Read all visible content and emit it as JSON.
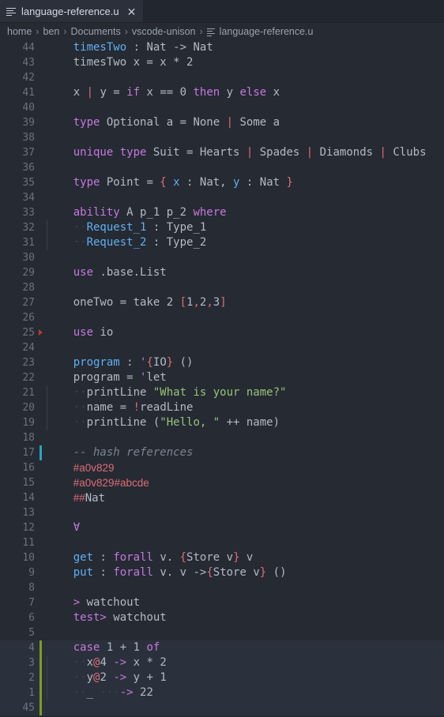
{
  "window": {
    "background": "#252a33",
    "accent_modified": "#7f9c22",
    "accent_cursor": "#2aa5bf"
  },
  "tab": {
    "icon": "file-lines-icon",
    "label": "language-reference.u",
    "close_label": "✕"
  },
  "breadcrumb": {
    "separator": "›",
    "items": [
      "home",
      "ben",
      "Documents",
      "vscode-unison"
    ],
    "file_icon": "file-lines-icon",
    "file": "language-reference.u"
  },
  "editor": {
    "language": "unison",
    "last_line_number": "45",
    "lines": [
      {
        "n": "44",
        "mark": "none",
        "tokens": [
          {
            "t": "    ",
            "c": "plain"
          },
          {
            "t": "timesTwo",
            "c": "fn"
          },
          {
            "t": " : ",
            "c": "plain"
          },
          {
            "t": "Nat",
            "c": "plain"
          },
          {
            "t": " -> ",
            "c": "plain"
          },
          {
            "t": "Nat",
            "c": "plain"
          }
        ]
      },
      {
        "n": "43",
        "mark": "none",
        "tokens": [
          {
            "t": "    timesTwo x = x * 2",
            "c": "plain"
          }
        ]
      },
      {
        "n": "42",
        "mark": "none",
        "tokens": []
      },
      {
        "n": "41",
        "mark": "none",
        "tokens": [
          {
            "t": "    x ",
            "c": "plain"
          },
          {
            "t": "|",
            "c": "pnc"
          },
          {
            "t": " y = ",
            "c": "plain"
          },
          {
            "t": "if",
            "c": "kw"
          },
          {
            "t": " x == 0 ",
            "c": "plain"
          },
          {
            "t": "then",
            "c": "kw"
          },
          {
            "t": " y ",
            "c": "plain"
          },
          {
            "t": "else",
            "c": "kw"
          },
          {
            "t": " x",
            "c": "plain"
          }
        ]
      },
      {
        "n": "40",
        "mark": "none",
        "tokens": []
      },
      {
        "n": "39",
        "mark": "none",
        "tokens": [
          {
            "t": "    ",
            "c": "plain"
          },
          {
            "t": "type",
            "c": "kw"
          },
          {
            "t": " Optional a = None ",
            "c": "plain"
          },
          {
            "t": "|",
            "c": "pnc"
          },
          {
            "t": " Some a",
            "c": "plain"
          }
        ]
      },
      {
        "n": "38",
        "mark": "none",
        "tokens": []
      },
      {
        "n": "37",
        "mark": "none",
        "tokens": [
          {
            "t": "    ",
            "c": "plain"
          },
          {
            "t": "unique type",
            "c": "kw"
          },
          {
            "t": " Suit = Hearts ",
            "c": "plain"
          },
          {
            "t": "|",
            "c": "pnc"
          },
          {
            "t": " Spades ",
            "c": "plain"
          },
          {
            "t": "|",
            "c": "pnc"
          },
          {
            "t": " Diamonds ",
            "c": "plain"
          },
          {
            "t": "|",
            "c": "pnc"
          },
          {
            "t": " Clubs",
            "c": "plain"
          }
        ]
      },
      {
        "n": "36",
        "mark": "none",
        "tokens": []
      },
      {
        "n": "35",
        "mark": "none",
        "tokens": [
          {
            "t": "    ",
            "c": "plain"
          },
          {
            "t": "type",
            "c": "kw"
          },
          {
            "t": " Point = ",
            "c": "plain"
          },
          {
            "t": "{",
            "c": "pnc"
          },
          {
            "t": " ",
            "c": "plain"
          },
          {
            "t": "x",
            "c": "fn"
          },
          {
            "t": " : Nat, ",
            "c": "plain"
          },
          {
            "t": "y",
            "c": "fn"
          },
          {
            "t": " : Nat ",
            "c": "plain"
          },
          {
            "t": "}",
            "c": "pnc"
          }
        ]
      },
      {
        "n": "34",
        "mark": "none",
        "tokens": []
      },
      {
        "n": "33",
        "mark": "none",
        "tokens": [
          {
            "t": "    ",
            "c": "plain"
          },
          {
            "t": "ability",
            "c": "kw"
          },
          {
            "t": " A p_1 p_2 ",
            "c": "plain"
          },
          {
            "t": "where",
            "c": "kw"
          }
        ]
      },
      {
        "n": "32",
        "mark": "none",
        "indent": 1,
        "tokens": [
          {
            "t": "    ",
            "c": "plain"
          },
          {
            "t": "··",
            "c": "dot"
          },
          {
            "t": "Request_1",
            "c": "fn"
          },
          {
            "t": " : Type_1",
            "c": "plain"
          }
        ]
      },
      {
        "n": "31",
        "mark": "none",
        "indent": 1,
        "tokens": [
          {
            "t": "    ",
            "c": "plain"
          },
          {
            "t": "··",
            "c": "dot"
          },
          {
            "t": "Request_2",
            "c": "fn"
          },
          {
            "t": " : Type_2",
            "c": "plain"
          }
        ]
      },
      {
        "n": "30",
        "mark": "none",
        "tokens": []
      },
      {
        "n": "29",
        "mark": "none",
        "tokens": [
          {
            "t": "    ",
            "c": "plain"
          },
          {
            "t": "use",
            "c": "kw"
          },
          {
            "t": " .base.List",
            "c": "plain"
          }
        ]
      },
      {
        "n": "28",
        "mark": "none",
        "tokens": []
      },
      {
        "n": "27",
        "mark": "none",
        "tokens": [
          {
            "t": "    oneTwo = take 2 ",
            "c": "plain"
          },
          {
            "t": "[",
            "c": "pnc"
          },
          {
            "t": "1",
            "c": "plain"
          },
          {
            "t": ",",
            "c": "pnc"
          },
          {
            "t": "2",
            "c": "plain"
          },
          {
            "t": ",",
            "c": "pnc"
          },
          {
            "t": "3",
            "c": "plain"
          },
          {
            "t": "]",
            "c": "pnc"
          }
        ]
      },
      {
        "n": "26",
        "mark": "none",
        "tokens": []
      },
      {
        "n": "25",
        "mark": "fold",
        "tokens": [
          {
            "t": "    ",
            "c": "plain"
          },
          {
            "t": "use",
            "c": "kw"
          },
          {
            "t": " io",
            "c": "plain"
          }
        ]
      },
      {
        "n": "24",
        "mark": "none",
        "tokens": []
      },
      {
        "n": "23",
        "mark": "none",
        "tokens": [
          {
            "t": "    ",
            "c": "plain"
          },
          {
            "t": "program",
            "c": "fn"
          },
          {
            "t": " : ",
            "c": "plain"
          },
          {
            "t": "'",
            "c": "kw"
          },
          {
            "t": "{",
            "c": "pnc"
          },
          {
            "t": "IO",
            "c": "plain"
          },
          {
            "t": "}",
            "c": "pnc"
          },
          {
            "t": " ()",
            "c": "plain"
          }
        ]
      },
      {
        "n": "22",
        "mark": "none",
        "tokens": [
          {
            "t": "    program = ",
            "c": "plain"
          },
          {
            "t": "'",
            "c": "kw"
          },
          {
            "t": "let",
            "c": "plain"
          }
        ]
      },
      {
        "n": "21",
        "mark": "none",
        "indent": 1,
        "tokens": [
          {
            "t": "    ",
            "c": "plain"
          },
          {
            "t": "··",
            "c": "dot"
          },
          {
            "t": "printLine ",
            "c": "plain"
          },
          {
            "t": "\"What is your name?\"",
            "c": "str"
          }
        ]
      },
      {
        "n": "20",
        "mark": "none",
        "indent": 1,
        "tokens": [
          {
            "t": "    ",
            "c": "plain"
          },
          {
            "t": "··",
            "c": "dot"
          },
          {
            "t": "name = ",
            "c": "plain"
          },
          {
            "t": "!",
            "c": "pnc"
          },
          {
            "t": "readLine",
            "c": "plain"
          }
        ]
      },
      {
        "n": "19",
        "mark": "none",
        "indent": 1,
        "tokens": [
          {
            "t": "    ",
            "c": "plain"
          },
          {
            "t": "··",
            "c": "dot"
          },
          {
            "t": "printLine (",
            "c": "plain"
          },
          {
            "t": "\"Hello, \"",
            "c": "str"
          },
          {
            "t": " ++ name)",
            "c": "plain"
          }
        ]
      },
      {
        "n": "18",
        "mark": "none",
        "tokens": []
      },
      {
        "n": "17",
        "mark": "cursorbar",
        "tokens": [
          {
            "t": "    ",
            "c": "plain"
          },
          {
            "t": "-- hash references",
            "c": "cmt"
          }
        ]
      },
      {
        "n": "16",
        "mark": "none",
        "tokens": [
          {
            "t": "    ",
            "c": "plain"
          },
          {
            "t": "#a0v829",
            "c": "hash"
          }
        ]
      },
      {
        "n": "15",
        "mark": "none",
        "tokens": [
          {
            "t": "    ",
            "c": "plain"
          },
          {
            "t": "#a0v829#abcde",
            "c": "hash"
          }
        ]
      },
      {
        "n": "14",
        "mark": "none",
        "tokens": [
          {
            "t": "    ",
            "c": "plain"
          },
          {
            "t": "##",
            "c": "hash"
          },
          {
            "t": "Nat",
            "c": "plain"
          }
        ]
      },
      {
        "n": "13",
        "mark": "none",
        "tokens": []
      },
      {
        "n": "12",
        "mark": "none",
        "tokens": [
          {
            "t": "    ",
            "c": "plain"
          },
          {
            "t": "∀",
            "c": "kw"
          }
        ]
      },
      {
        "n": "11",
        "mark": "none",
        "tokens": []
      },
      {
        "n": "10",
        "mark": "none",
        "tokens": [
          {
            "t": "    ",
            "c": "plain"
          },
          {
            "t": "get",
            "c": "fn"
          },
          {
            "t": " : ",
            "c": "plain"
          },
          {
            "t": "forall",
            "c": "kw"
          },
          {
            "t": " v. ",
            "c": "plain"
          },
          {
            "t": "{",
            "c": "pnc"
          },
          {
            "t": "Store v",
            "c": "plain"
          },
          {
            "t": "}",
            "c": "pnc"
          },
          {
            "t": " v",
            "c": "plain"
          }
        ]
      },
      {
        "n": "9",
        "mark": "none",
        "tokens": [
          {
            "t": "    ",
            "c": "plain"
          },
          {
            "t": "put",
            "c": "fn"
          },
          {
            "t": " : ",
            "c": "plain"
          },
          {
            "t": "forall",
            "c": "kw"
          },
          {
            "t": " v. v ->",
            "c": "plain"
          },
          {
            "t": "{",
            "c": "pnc"
          },
          {
            "t": "Store v",
            "c": "plain"
          },
          {
            "t": "}",
            "c": "pnc"
          },
          {
            "t": " ()",
            "c": "plain"
          }
        ]
      },
      {
        "n": "8",
        "mark": "none",
        "tokens": []
      },
      {
        "n": "7",
        "mark": "none",
        "tokens": [
          {
            "t": "    ",
            "c": "plain"
          },
          {
            "t": ">",
            "c": "kw"
          },
          {
            "t": " watchout",
            "c": "plain"
          }
        ]
      },
      {
        "n": "6",
        "mark": "none",
        "tokens": [
          {
            "t": "    ",
            "c": "plain"
          },
          {
            "t": "test>",
            "c": "kw"
          },
          {
            "t": " watchout",
            "c": "plain"
          }
        ]
      },
      {
        "n": "5",
        "mark": "none",
        "tokens": []
      },
      {
        "n": "4",
        "mark": "git",
        "current": true,
        "tokens": [
          {
            "t": "    ",
            "c": "plain"
          },
          {
            "t": "case",
            "c": "kw"
          },
          {
            "t": " 1 + 1 ",
            "c": "plain"
          },
          {
            "t": "of",
            "c": "kw"
          }
        ]
      },
      {
        "n": "3",
        "mark": "git",
        "current": true,
        "indent": 1,
        "tokens": [
          {
            "t": "    ",
            "c": "plain"
          },
          {
            "t": "··",
            "c": "dot"
          },
          {
            "t": "x",
            "c": "plain"
          },
          {
            "t": "@",
            "c": "pnc"
          },
          {
            "t": "4 ",
            "c": "plain"
          },
          {
            "t": "->",
            "c": "kw"
          },
          {
            "t": " x * 2",
            "c": "plain"
          }
        ]
      },
      {
        "n": "2",
        "mark": "git",
        "current": true,
        "indent": 1,
        "tokens": [
          {
            "t": "    ",
            "c": "plain"
          },
          {
            "t": "··",
            "c": "dot"
          },
          {
            "t": "y",
            "c": "plain"
          },
          {
            "t": "@",
            "c": "pnc"
          },
          {
            "t": "2 ",
            "c": "plain"
          },
          {
            "t": "->",
            "c": "kw"
          },
          {
            "t": " y + 1",
            "c": "plain"
          }
        ]
      },
      {
        "n": "1",
        "mark": "git",
        "current": true,
        "indent": 1,
        "tokens": [
          {
            "t": "    ",
            "c": "plain"
          },
          {
            "t": "··",
            "c": "dot"
          },
          {
            "t": "_ ",
            "c": "plain"
          },
          {
            "t": "···",
            "c": "dot"
          },
          {
            "t": "->",
            "c": "kw"
          },
          {
            "t": " 22",
            "c": "plain"
          }
        ]
      },
      {
        "n": "45",
        "mark": "git",
        "current": true,
        "tokens": []
      }
    ]
  }
}
